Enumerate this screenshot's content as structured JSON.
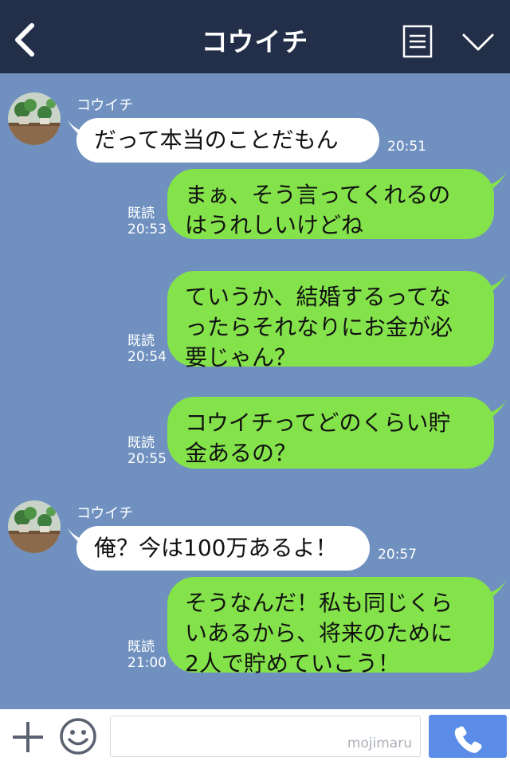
{
  "header": {
    "title": "コウイチ"
  },
  "messages": [
    {
      "side": "in",
      "sender": "コウイチ",
      "text": "だって本当のことだもん",
      "time": "20:51"
    },
    {
      "side": "out",
      "read": "既読",
      "time": "20:53",
      "lines": [
        "まぁ、そう言ってくれるの",
        "はうれしいけどね"
      ]
    },
    {
      "side": "out",
      "read": "既読",
      "time": "20:54",
      "lines": [
        "ていうか、結婚するってな",
        "ったらそれなりにお金が必",
        "要じゃん？"
      ]
    },
    {
      "side": "out",
      "read": "既読",
      "time": "20:55",
      "lines": [
        "コウイチってどのくらい貯",
        "金あるの？"
      ]
    },
    {
      "side": "in",
      "sender": "コウイチ",
      "text": "俺？今は100万あるよ！",
      "time": "20:57"
    },
    {
      "side": "out",
      "read": "既読",
      "time": "21:00",
      "lines": [
        "そうなんだ！私も同じくら",
        "いあるから、将来のために",
        "2人で貯めていこう！"
      ]
    }
  ],
  "input": {
    "value": "",
    "watermark": "mojimaru"
  },
  "icons": {
    "back": "chevron-left-icon",
    "menu": "menu-icon",
    "collapse": "chevron-down-icon",
    "plus": "plus-icon",
    "emoji": "smiley-icon",
    "call": "phone-icon"
  },
  "colors": {
    "header_bg": "#232e48",
    "chat_bg": "#7091c0",
    "bubble_out": "#84e24a",
    "bubble_in": "#ffffff",
    "call_button": "#5a8ce8"
  }
}
